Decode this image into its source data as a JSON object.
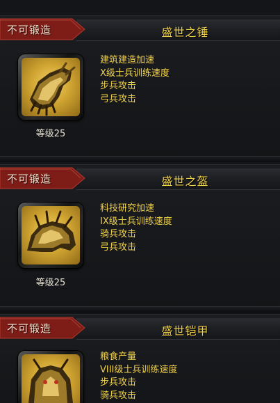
{
  "equipment": [
    {
      "forge_status": "不可锻造",
      "name": "盛世之锤",
      "level_text": "等级25",
      "attributes": [
        "建筑建造加速",
        "X级士兵训练速度",
        "步兵攻击",
        "弓兵攻击"
      ],
      "icon": "gauntlet-icon"
    },
    {
      "forge_status": "不可锻造",
      "name": "盛世之盔",
      "level_text": "等级25",
      "attributes": [
        "科技研究加速",
        "IX级士兵训练速度",
        "骑兵攻击",
        "弓兵攻击"
      ],
      "icon": "helmet-icon"
    },
    {
      "forge_status": "不可锻造",
      "name": "盛世铠甲",
      "level_text": "",
      "attributes": [
        "粮食产量",
        "VIII级士兵训练速度",
        "步兵攻击",
        "骑兵攻击"
      ],
      "icon": "armor-icon"
    }
  ],
  "colors": {
    "ribbon": "#7e1d18",
    "title_gold": "#f2d24a",
    "panel_dark": "#16181b"
  }
}
